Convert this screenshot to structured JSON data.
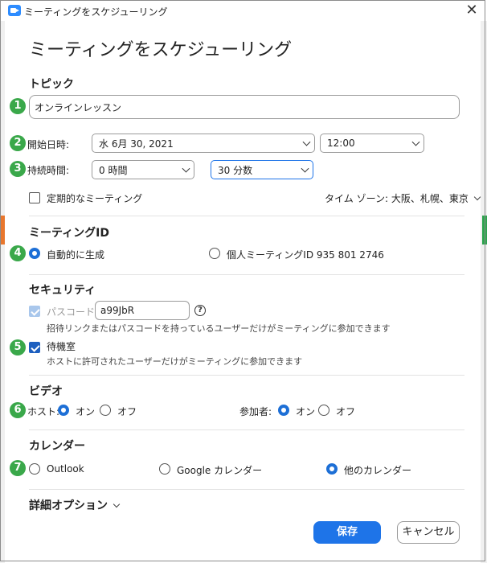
{
  "window": {
    "title": "ミーティングをスケジューリング"
  },
  "dialog_title": "ミーティングをスケジューリング",
  "topic": {
    "label": "トピック",
    "value": "オンラインレッスン"
  },
  "start": {
    "label": "開始日時:",
    "date": "水  6月  30, 2021",
    "time": "12:00"
  },
  "duration": {
    "label": "持続時間:",
    "hours": "0 時間",
    "minutes": "30 分数"
  },
  "recurring": {
    "label": "定期的なミーティング",
    "checked": false
  },
  "timezone": {
    "label": "タイム ゾーン: 大阪、札幌、東京"
  },
  "meeting_id": {
    "section": "ミーティングID",
    "auto_label": "自動的に生成",
    "personal_label": "個人ミーティングID 935 801 2746",
    "selected": "auto"
  },
  "security": {
    "section": "セキュリティ",
    "passcode_label": "パスコード",
    "passcode_value": "a99JbR",
    "passcode_note": "招待リンクまたはパスコードを持っているユーザーだけがミーティングに参加できます",
    "waiting_room_label": "待機室",
    "waiting_room_note": "ホストに許可されたユーザーだけがミーティングに参加できます"
  },
  "video": {
    "section": "ビデオ",
    "host_label": "ホスト:",
    "participant_label": "参加者:",
    "on": "オン",
    "off": "オフ"
  },
  "calendar": {
    "section": "カレンダー",
    "outlook": "Outlook",
    "google": "Google カレンダー",
    "other": "他のカレンダー",
    "selected": "other"
  },
  "advanced": {
    "label": "詳細オプション"
  },
  "buttons": {
    "save": "保存",
    "cancel": "キャンセル"
  },
  "step_numbers": [
    "1",
    "2",
    "3",
    "4",
    "5",
    "6",
    "7"
  ],
  "colors": {
    "accent": "#1e74e8",
    "step_badge": "#3aa84a"
  }
}
